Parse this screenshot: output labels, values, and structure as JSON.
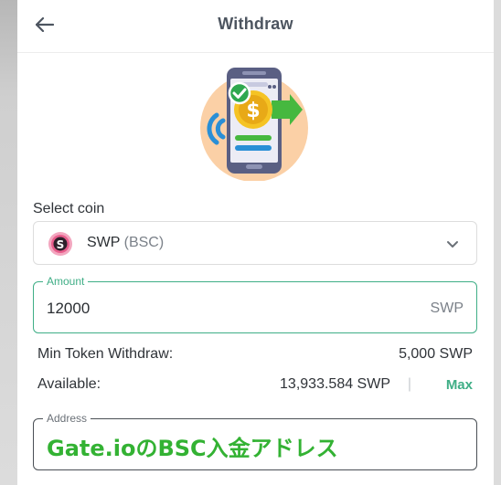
{
  "header": {
    "title": "Withdraw",
    "back_icon": "arrow-left-icon"
  },
  "illustration": {
    "icon": "phone-transfer-icon",
    "currency_symbol": "$"
  },
  "select_coin": {
    "label": "Select coin",
    "coin_symbol": "SWP",
    "network": "(BSC)",
    "coin_icon": "swp-coin-icon",
    "dropdown_icon": "chevron-down-icon"
  },
  "amount": {
    "legend": "Amount",
    "value": "12000",
    "unit": "SWP"
  },
  "min_withdraw": {
    "label": "Min Token Withdraw:",
    "value": "5,000 SWP"
  },
  "available": {
    "label": "Available:",
    "value": "13,933.584 SWP",
    "separator": "|",
    "max_label": "Max"
  },
  "address": {
    "legend": "Address",
    "value": "Gate.ioのBSC入金アドレス"
  },
  "colors": {
    "accent": "#3fae86",
    "title": "#4d5560",
    "address_text": "#33b233",
    "illustration_bg": "#fbd0a6",
    "coin_icon": "#e85d8c"
  }
}
